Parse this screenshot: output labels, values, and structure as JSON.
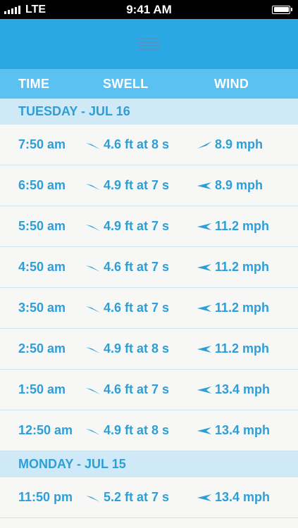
{
  "status_bar": {
    "carrier": "LTE",
    "time": "9:41 AM"
  },
  "columns": {
    "time": "TIME",
    "swell": "SWELL",
    "wind": "WIND"
  },
  "sections": [
    {
      "title": "TUESDAY - JUL 16",
      "rows": [
        {
          "time": "7:50 am",
          "swell": "4.6 ft at 8 s",
          "wind": "8.9 mph",
          "wind_arrow": "wind-arrow-up-left-icon"
        },
        {
          "time": "6:50 am",
          "swell": "4.9 ft at 7 s",
          "wind": "8.9 mph",
          "wind_arrow": "wind-arrow-left-icon"
        },
        {
          "time": "5:50 am",
          "swell": "4.9 ft at 7 s",
          "wind": "11.2 mph",
          "wind_arrow": "wind-arrow-left-icon"
        },
        {
          "time": "4:50 am",
          "swell": "4.6 ft at 7 s",
          "wind": "11.2 mph",
          "wind_arrow": "wind-arrow-left-icon"
        },
        {
          "time": "3:50 am",
          "swell": "4.6 ft at 7 s",
          "wind": "11.2 mph",
          "wind_arrow": "wind-arrow-left-icon"
        },
        {
          "time": "2:50 am",
          "swell": "4.9 ft at 8 s",
          "wind": "11.2 mph",
          "wind_arrow": "wind-arrow-left-icon"
        },
        {
          "time": "1:50 am",
          "swell": "4.6 ft at 7 s",
          "wind": "13.4 mph",
          "wind_arrow": "wind-arrow-left-icon"
        },
        {
          "time": "12:50 am",
          "swell": "4.9 ft at 8 s",
          "wind": "13.4 mph",
          "wind_arrow": "wind-arrow-left-icon"
        }
      ]
    },
    {
      "title": "MONDAY - JUL 15",
      "rows": [
        {
          "time": "11:50 pm",
          "swell": "5.2 ft at 7 s",
          "wind": "13.4 mph",
          "wind_arrow": "wind-arrow-left-icon"
        }
      ]
    }
  ],
  "colors": {
    "nav_header": "#29a8e3",
    "column_header": "#5bc1f0",
    "section_header": "#cfe9f6",
    "text_accent": "#2d9fd8",
    "row_background": "#f7f7f5"
  }
}
